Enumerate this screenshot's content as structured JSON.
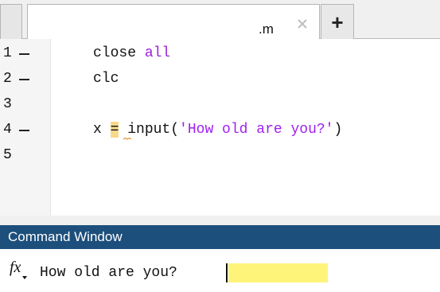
{
  "tabs": {
    "file_name": ".m",
    "add_label": "+"
  },
  "editor": {
    "lines": [
      {
        "number": "1",
        "breakpoint_marker": true
      },
      {
        "number": "2",
        "breakpoint_marker": true
      },
      {
        "number": "3",
        "breakpoint_marker": false
      },
      {
        "number": "4",
        "breakpoint_marker": true
      },
      {
        "number": "5",
        "breakpoint_marker": false
      }
    ],
    "code": {
      "line1_cmd": "close ",
      "line1_arg": "all",
      "line2": "clc",
      "line4_var": "x ",
      "line4_eq": "=",
      "line4_call": " input(",
      "line4_str": "'How old are you?'",
      "line4_close": ")"
    },
    "colors": {
      "keyword": "#9b1fd6",
      "string": "#a020f0",
      "warning_highlight": "#f7d98a"
    }
  },
  "command_window": {
    "title": "Command Window",
    "prompt_icon": "fx-icon",
    "prompt_text": "How old are you?",
    "input_highlight": "#fff47a",
    "header_color": "#1d4f7c"
  }
}
